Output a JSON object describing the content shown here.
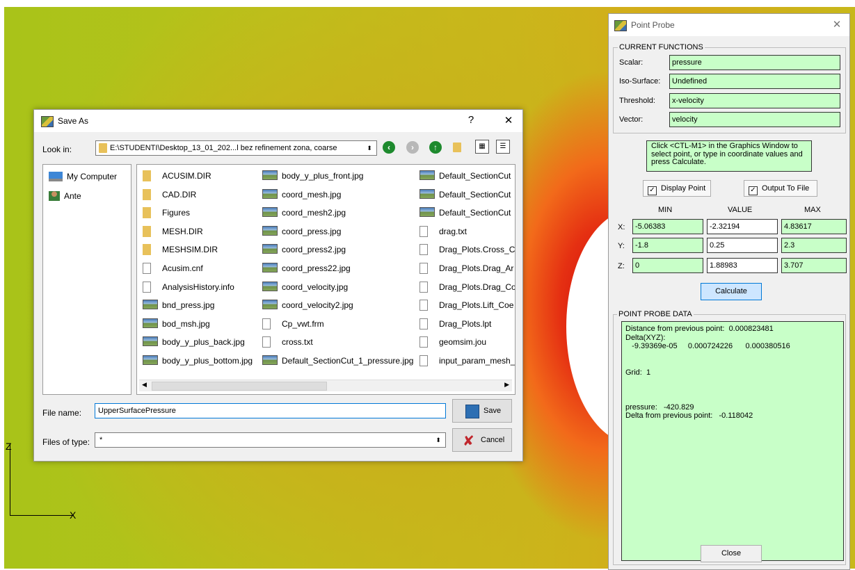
{
  "background": {
    "axis_z": "Z",
    "axis_x": "X"
  },
  "save_dialog": {
    "title": "Save As",
    "help": "?",
    "close": "✕",
    "look_in_label": "Look in:",
    "look_in_value": "E:\\STUDENTI\\Desktop_13_01_202...l bez refinement zona, coarse",
    "sidebar": [
      {
        "label": "My Computer",
        "icon": "computer-icon"
      },
      {
        "label": "Ante",
        "icon": "user-icon"
      }
    ],
    "files_col1": [
      {
        "name": "ACUSIM.DIR",
        "type": "folder"
      },
      {
        "name": "CAD.DIR",
        "type": "folder"
      },
      {
        "name": "Figures",
        "type": "folder"
      },
      {
        "name": "MESH.DIR",
        "type": "folder"
      },
      {
        "name": "MESHSIM.DIR",
        "type": "folder"
      },
      {
        "name": "Acusim.cnf",
        "type": "doc"
      },
      {
        "name": "AnalysisHistory.info",
        "type": "doc"
      },
      {
        "name": "bnd_press.jpg",
        "type": "img"
      },
      {
        "name": "bod_msh.jpg",
        "type": "img"
      },
      {
        "name": "body_y_plus_back.jpg",
        "type": "img"
      },
      {
        "name": "body_y_plus_bottom.jpg",
        "type": "img"
      }
    ],
    "files_col2": [
      {
        "name": "body_y_plus_front.jpg",
        "type": "img"
      },
      {
        "name": "coord_mesh.jpg",
        "type": "img"
      },
      {
        "name": "coord_mesh2.jpg",
        "type": "img"
      },
      {
        "name": "coord_press.jpg",
        "type": "img"
      },
      {
        "name": "coord_press2.jpg",
        "type": "img"
      },
      {
        "name": "coord_press22.jpg",
        "type": "img"
      },
      {
        "name": "coord_velocity.jpg",
        "type": "img"
      },
      {
        "name": "coord_velocity2.jpg",
        "type": "img"
      },
      {
        "name": "Cp_vwt.frm",
        "type": "doc"
      },
      {
        "name": "cross.txt",
        "type": "doc"
      },
      {
        "name": "Default_SectionCut_1_pressure.jpg",
        "type": "img"
      }
    ],
    "files_col3": [
      {
        "name": "Default_SectionCut",
        "type": "img"
      },
      {
        "name": "Default_SectionCut",
        "type": "img"
      },
      {
        "name": "Default_SectionCut",
        "type": "img"
      },
      {
        "name": "drag.txt",
        "type": "doc"
      },
      {
        "name": "Drag_Plots.Cross_C",
        "type": "doc"
      },
      {
        "name": "Drag_Plots.Drag_Ar",
        "type": "doc"
      },
      {
        "name": "Drag_Plots.Drag_Co",
        "type": "doc"
      },
      {
        "name": "Drag_Plots.Lift_Coe",
        "type": "doc"
      },
      {
        "name": "Drag_Plots.lpt",
        "type": "doc"
      },
      {
        "name": "geomsim.jou",
        "type": "doc"
      },
      {
        "name": "input_param_mesh_",
        "type": "doc"
      }
    ],
    "file_name_label": "File name:",
    "file_name_value": "UpperSurfacePressure",
    "file_type_label": "Files of type:",
    "file_type_value": "*",
    "save_label": "Save",
    "cancel_label": "Cancel"
  },
  "point_probe": {
    "title": "Point Probe",
    "close_x": "✕",
    "current_functions_title": "CURRENT FUNCTIONS",
    "scalar_label": "Scalar:",
    "scalar_value": "pressure",
    "iso_label": "Iso-Surface:",
    "iso_value": "Undefined",
    "threshold_label": "Threshold:",
    "threshold_value": "x-velocity",
    "vector_label": "Vector:",
    "vector_value": "velocity",
    "hint": "Click <CTL-M1> in the Graphics Window to select point, or type in coordinate values and press Calculate.",
    "display_point_label": "Display Point",
    "output_to_file_label": "Output To File",
    "col_min": "MIN",
    "col_value": "VALUE",
    "col_max": "MAX",
    "rows": [
      {
        "axis": "X:",
        "min": "-5.06383",
        "value": "-2.32194",
        "max": "4.83617"
      },
      {
        "axis": "Y:",
        "min": "-1.8",
        "value": "0.25",
        "max": "2.3"
      },
      {
        "axis": "Z:",
        "min": "0",
        "value": "1.88983",
        "max": "3.707"
      }
    ],
    "calculate_label": "Calculate",
    "probe_data_title": "POINT PROBE DATA",
    "probe_data_text": "Distance from previous point:  0.000823481\nDelta(XYZ):\n   -9.39369e-05     0.000724226      0.000380516\n\n\nGrid:  1\n\n\n\npressure:   -420.829\nDelta from previous point:   -0.118042",
    "close_label": "Close"
  }
}
